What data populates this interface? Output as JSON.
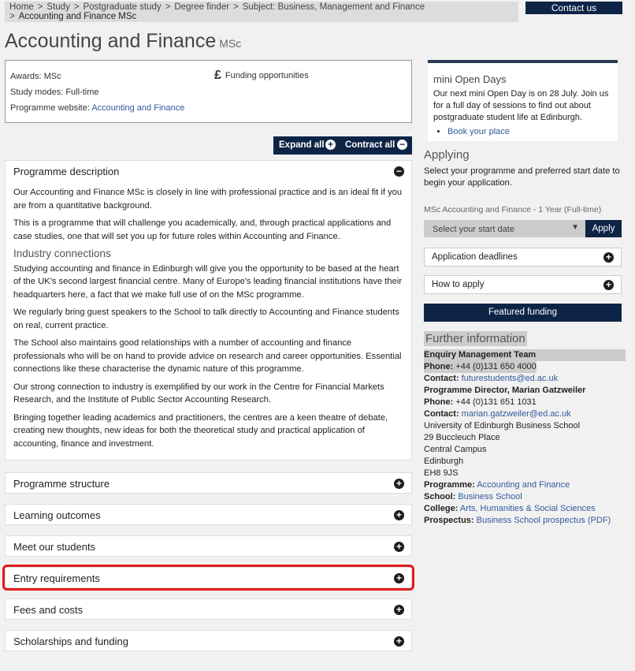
{
  "breadcrumb": {
    "items": [
      "Home",
      "Study",
      "Postgraduate study",
      "Degree finder",
      "Subject: Business, Management and Finance"
    ],
    "current": "Accounting and Finance MSc",
    "separator": ">"
  },
  "header": {
    "contact_label": "Contact us"
  },
  "page": {
    "title": "Accounting and Finance",
    "subtitle": "MSc"
  },
  "info": {
    "awards_label": "Awards:",
    "awards_value": "MSc",
    "modes_label": "Study modes:",
    "modes_value": "Full-time",
    "website_label": "Programme website:",
    "website_link": "Accounting and Finance",
    "funding_symbol": "£",
    "funding_label": "Funding opportunities"
  },
  "controls": {
    "expand_label": "Expand all",
    "contract_label": "Contract all",
    "plus": "+",
    "minus": "−"
  },
  "description": {
    "heading": "Programme description",
    "p1": "Our Accounting and Finance MSc is closely in line with professional practice and is an ideal fit if you are from a quantitative background.",
    "p2": "This is a programme that will challenge you academically, and, through practical applications and case studies, one that will set you up for future roles within Accounting and Finance.",
    "subheading": "Industry connections",
    "p3": "Studying accounting and finance in Edinburgh will give you the opportunity to be based at the heart of the UK's second largest financial centre. Many of Europe's leading financial institutions have their headquarters here, a fact that we make full use of on the MSc programme.",
    "p4": "We regularly bring guest speakers to the School to talk directly to Accounting and Finance students on real, current practice.",
    "p5": "The School also maintains good relationships with a number of accounting and finance professionals who will be on hand to provide advice on research and career opportunities. Essential connections like these characterise the dynamic nature of this programme.",
    "p6": "Our strong connection to industry is exemplified by our work in the Centre for Financial Markets Research, and the Institute of Public Sector Accounting Research.",
    "p7": "Bringing together leading academics and practitioners, the centres are a keen theatre of debate, creating new thoughts, new ideas for both the theoretical study and practical application of accounting, finance and investment."
  },
  "sections": [
    {
      "label": "Programme structure"
    },
    {
      "label": "Learning outcomes"
    },
    {
      "label": "Meet our students"
    },
    {
      "label": "Entry requirements"
    },
    {
      "label": "Fees and costs"
    },
    {
      "label": "Scholarships and funding"
    }
  ],
  "open_days": {
    "title": "mini Open Days",
    "text": "Our next mini Open Day is on 28 July. Join us for a full day of sessions to find out about postgraduate student life at Edinburgh.",
    "link": "Book your place"
  },
  "applying": {
    "title": "Applying",
    "text": "Select your programme and preferred start date to begin your application.",
    "programme_label": "MSc Accounting and Finance - 1 Year (Full-time)",
    "select_placeholder": "Select your start date",
    "apply_label": "Apply",
    "deadlines_label": "Application deadlines",
    "how_label": "How to apply",
    "featured_label": "Featured funding"
  },
  "further": {
    "title": "Further information",
    "team": "Enquiry Management Team",
    "phone1_label": "Phone:",
    "phone1": "+44 (0)131 650 4000",
    "contact1_label": "Contact:",
    "email1": "futurestudents@ed.ac.uk",
    "director": "Programme Director, Marian Gatzweiler",
    "phone2_label": "Phone:",
    "phone2": "+44 (0)131 651 1031",
    "contact2_label": "Contact:",
    "email2": "marian.gatzweiler@ed.ac.uk",
    "address1": "University of Edinburgh Business School",
    "address2": "29 Buccleuch Place",
    "address3": "Central Campus",
    "address4": "Edinburgh",
    "address5": "EH8 9JS",
    "programme_label": "Programme:",
    "programme_link": "Accounting and Finance",
    "school_label": "School:",
    "school_link": "Business School",
    "college_label": "College:",
    "college_link": "Arts, Humanities & Social Sciences",
    "prospectus_label": "Prospectus:",
    "prospectus_link": "Business School prospectus (PDF)"
  }
}
